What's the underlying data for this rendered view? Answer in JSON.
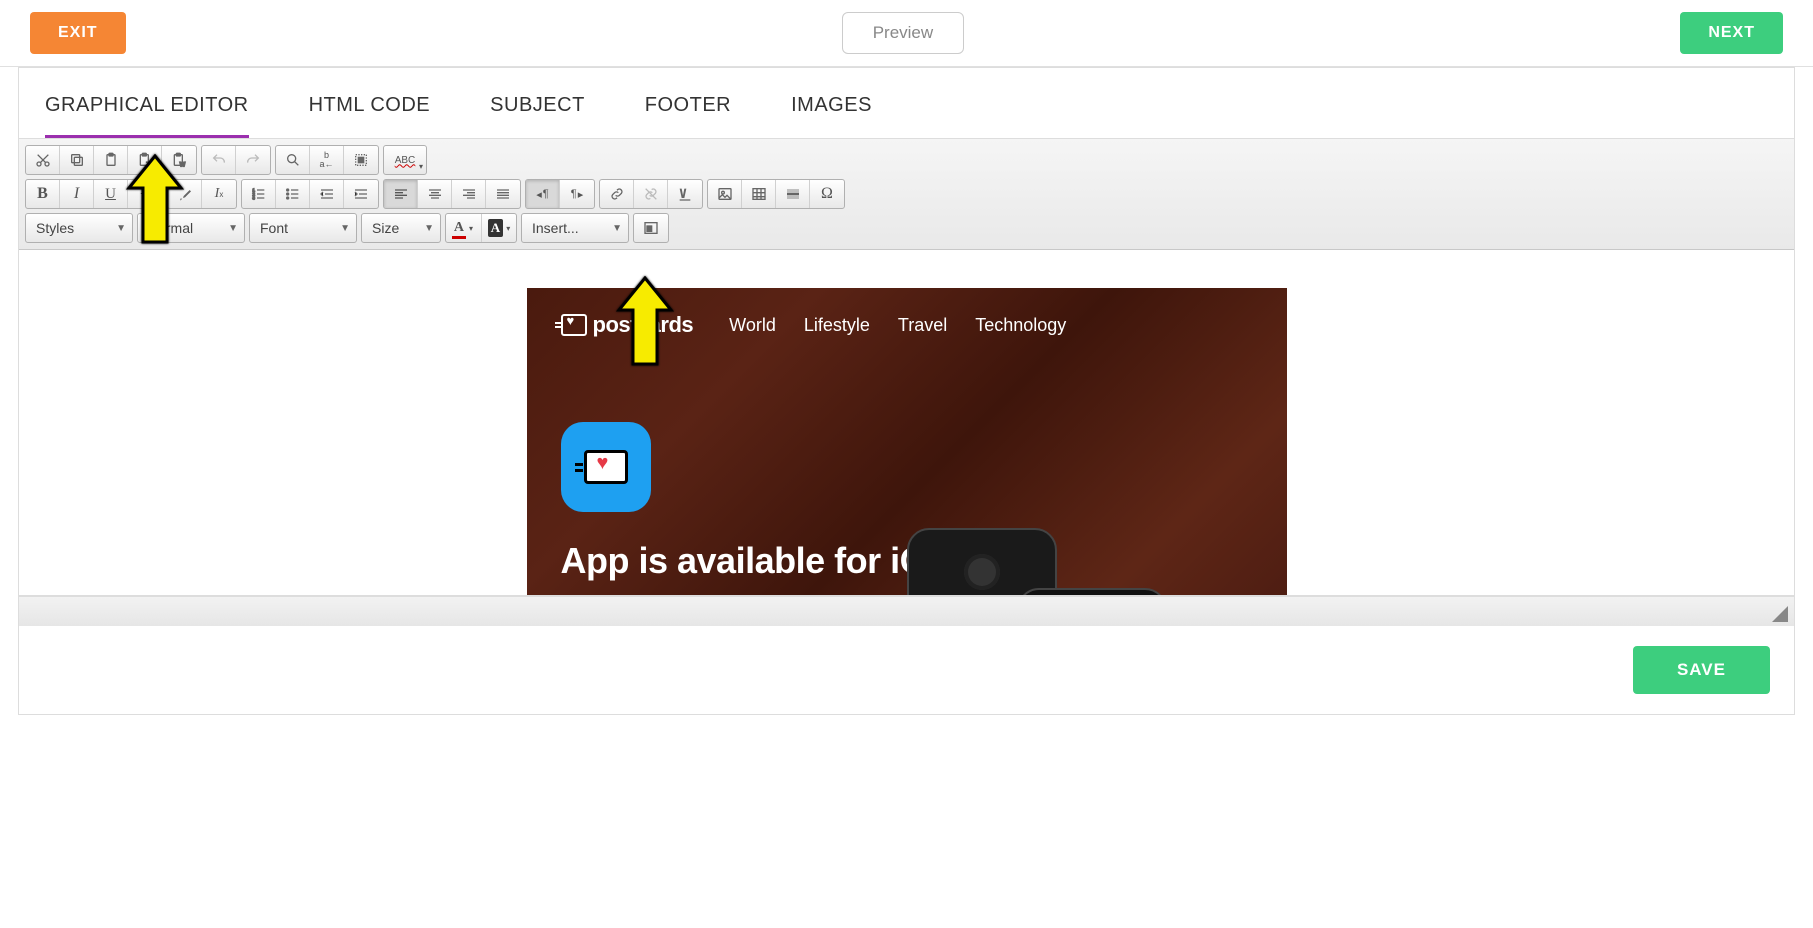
{
  "topbar": {
    "exit": "EXIT",
    "preview": "Preview",
    "next": "NEXT"
  },
  "tabs": [
    {
      "label": "GRAPHICAL EDITOR",
      "active": true
    },
    {
      "label": "HTML CODE",
      "active": false
    },
    {
      "label": "SUBJECT",
      "active": false
    },
    {
      "label": "FOOTER",
      "active": false
    },
    {
      "label": "IMAGES",
      "active": false
    }
  ],
  "toolbar": {
    "styles": "Styles",
    "format": "Normal",
    "font": "Font",
    "size": "Size",
    "insert": "Insert...",
    "spellcheck": "ABC",
    "rtl_marker": "¶",
    "ltr_marker": "¶"
  },
  "email": {
    "brand": "postcards",
    "nav": [
      "World",
      "Lifestyle",
      "Travel",
      "Technology"
    ],
    "headline": "App is available for iOS"
  },
  "footer": {
    "save": "SAVE"
  },
  "colors": {
    "accent_orange": "#f58634",
    "accent_green": "#3dce7e",
    "accent_purple": "#9b2fae",
    "arrow": "#f7eb00"
  }
}
